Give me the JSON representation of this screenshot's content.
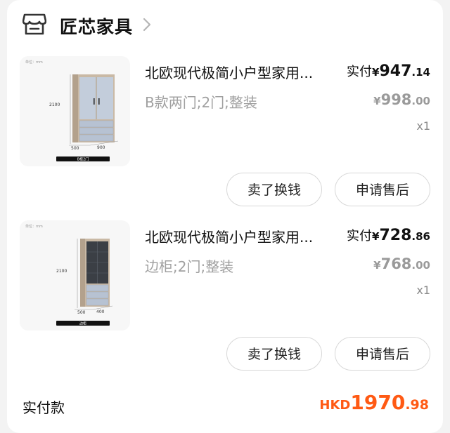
{
  "shop": {
    "name": "匠芯家具",
    "icon": "store-icon",
    "chevron": "chevron-right-icon"
  },
  "items": [
    {
      "title": "北欧现代极简小户型家用...",
      "spec": "B款两门;2门;整装",
      "paid_label": "实付",
      "paid_currency": "¥",
      "paid_int": "947",
      "paid_dec": ".14",
      "orig_currency": "¥",
      "orig_int": "998",
      "orig_dec": ".00",
      "qty": "x1",
      "image": {
        "unit_label": "单位：mm",
        "height_dim": "2100",
        "width_dim": "500",
        "depth_dim": "900",
        "caption": "B柜2门"
      },
      "buttons": {
        "sell": "卖了换钱",
        "aftersale": "申请售后"
      }
    },
    {
      "title": "北欧现代极简小户型家用...",
      "spec": "边柜;2门;整装",
      "paid_label": "实付",
      "paid_currency": "¥",
      "paid_int": "728",
      "paid_dec": ".86",
      "orig_currency": "¥",
      "orig_int": "768",
      "orig_dec": ".00",
      "qty": "x1",
      "image": {
        "unit_label": "单位：mm",
        "height_dim": "2100",
        "width_dim": "500",
        "depth_dim": "400",
        "caption": "边柜"
      },
      "buttons": {
        "sell": "卖了换钱",
        "aftersale": "申请售后"
      }
    }
  ],
  "footer": {
    "total_label": "实付款",
    "currency": "HKD",
    "total_int": "1970",
    "total_dec": ".98"
  },
  "colors": {
    "accent": "#ff5a14",
    "muted": "#9a9a9a",
    "cabinet": "#c8b8a4",
    "door_light": "#bcc8d6",
    "door_glass": "#3d4147"
  }
}
